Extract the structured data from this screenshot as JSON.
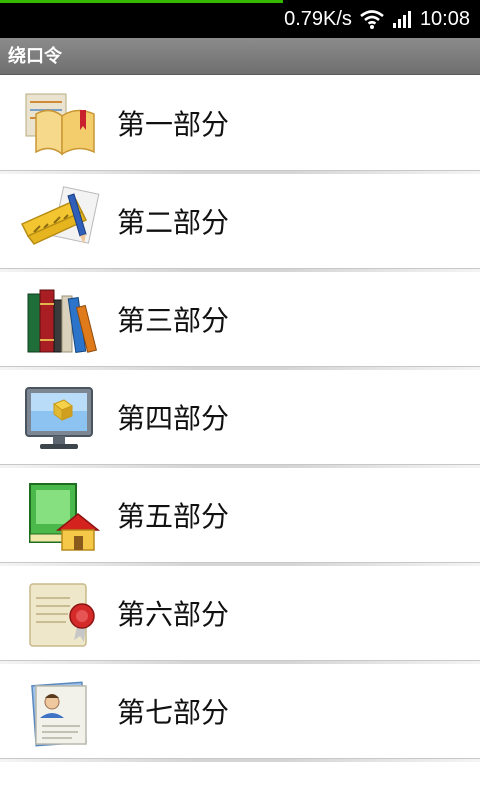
{
  "status_bar": {
    "network_speed": "0.79K/s",
    "time": "10:08",
    "wifi_icon": "wifi-icon",
    "signal_icon": "cell-signal-icon",
    "progress_color": "#35b800",
    "progress_fraction": 0.59
  },
  "title_bar": {
    "title": "绕口令"
  },
  "list": {
    "items": [
      {
        "label": "第一部分",
        "icon": "open-book-icon"
      },
      {
        "label": "第二部分",
        "icon": "ruler-pencil-icon"
      },
      {
        "label": "第三部分",
        "icon": "books-icon"
      },
      {
        "label": "第四部分",
        "icon": "monitor-icon"
      },
      {
        "label": "第五部分",
        "icon": "book-house-icon"
      },
      {
        "label": "第六部分",
        "icon": "certificate-seal-icon"
      },
      {
        "label": "第七部分",
        "icon": "contact-card-icon"
      }
    ]
  }
}
